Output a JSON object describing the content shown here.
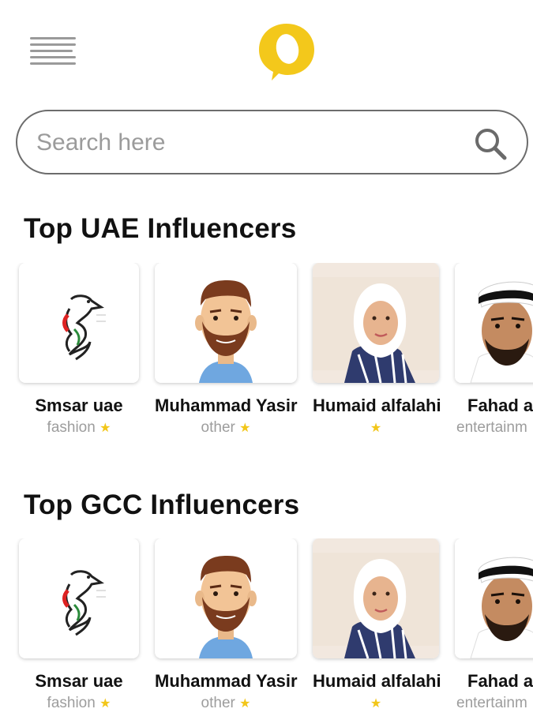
{
  "header": {
    "menu_icon": "hamburger-menu-icon",
    "logo_icon": "speech-bubble-logo-icon",
    "brand_color": "#f3c81b"
  },
  "search": {
    "placeholder": "Search here",
    "value": "",
    "icon": "search-icon"
  },
  "sections": [
    {
      "title": "Top UAE Influencers",
      "items": [
        {
          "name": "Smsar uae",
          "category": "fashion",
          "star": "★",
          "avatar": "falcon-logo"
        },
        {
          "name": "Muhammad Yasir",
          "category": "other",
          "star": "★",
          "avatar": "bearded-man-cartoon"
        },
        {
          "name": "Humaid alfalahi",
          "category": "",
          "star": "★",
          "avatar": "woman-hijab-photo"
        },
        {
          "name": "Fahad a",
          "category": "entertainm",
          "star": "",
          "avatar": "man-ghutra-photo"
        }
      ]
    },
    {
      "title": "Top GCC Influencers",
      "items": [
        {
          "name": "Smsar uae",
          "category": "fashion",
          "star": "★",
          "avatar": "falcon-logo"
        },
        {
          "name": "Muhammad Yasir",
          "category": "other",
          "star": "★",
          "avatar": "bearded-man-cartoon"
        },
        {
          "name": "Humaid alfalahi",
          "category": "",
          "star": "★",
          "avatar": "woman-hijab-photo"
        },
        {
          "name": "Fahad a",
          "category": "entertainm",
          "star": "",
          "avatar": "man-ghutra-photo"
        }
      ]
    }
  ],
  "colors": {
    "star": "#f2c619",
    "muted_text": "#9d9d9d",
    "title": "#111111"
  }
}
